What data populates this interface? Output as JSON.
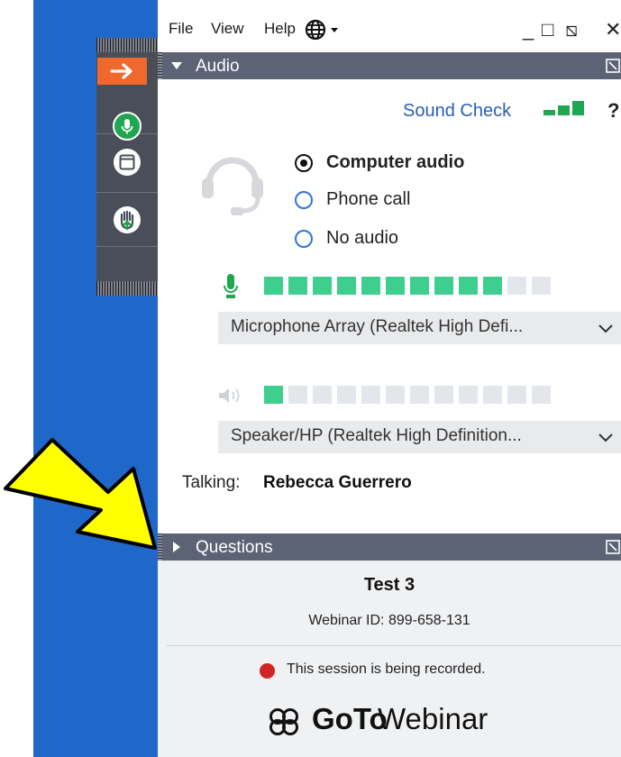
{
  "menu": {
    "file": "File",
    "view": "View",
    "help": "Help"
  },
  "window_controls": {
    "minimize": "_",
    "maximize": "□",
    "restore": "⧅",
    "close": "✕"
  },
  "audio": {
    "header": "Audio",
    "sound_check": "Sound Check",
    "help_mark": "?",
    "options": [
      {
        "label": "Computer audio",
        "selected": true
      },
      {
        "label": "Phone call",
        "selected": false
      },
      {
        "label": "No audio",
        "selected": false
      }
    ],
    "microphone": {
      "device": "Microphone Array (Realtek High Defi...",
      "level_segments_lit": 10,
      "segments_total": 12
    },
    "speaker": {
      "device": "Speaker/HP (Realtek High Definition...",
      "level_segments_lit": 1,
      "segments_total": 12
    },
    "talking_label": "Talking:",
    "talking_name": "Rebecca Guerrero"
  },
  "questions": {
    "header": "Questions"
  },
  "session": {
    "title": "Test 3",
    "webinar_id": "Webinar ID: 899-658-131",
    "recording_notice": "This session is being recorded."
  },
  "brand": {
    "logo_bold": "GoTo",
    "logo_light": "Webinar"
  },
  "colors": {
    "desktop_blue": "#1f67c8",
    "header_gray": "#5b6374",
    "accent_green": "#1fa651",
    "meter_on": "#3ecf8e",
    "meter_off": "#e3e6ea",
    "toolbar_orange": "#f0682c",
    "record_red": "#d22424",
    "pointer_yellow": "#ffff00"
  },
  "icons": [
    "arrow-right-icon",
    "microphone-icon",
    "window-icon",
    "raise-hand-icon",
    "globe-icon",
    "headset-icon",
    "speaker-icon",
    "chevron-down-icon",
    "popout-icon",
    "goto-logo-icon",
    "yellow-pointer-arrow"
  ]
}
